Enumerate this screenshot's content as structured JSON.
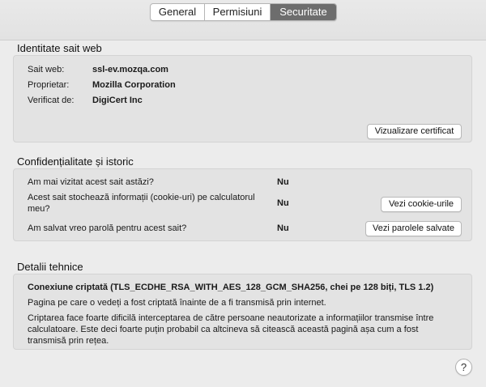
{
  "tabs": [
    "General",
    "Permisiuni",
    "Securitate"
  ],
  "identity": {
    "title": "Identitate sait web",
    "site_label": "Sait web:",
    "site_value": "ssl-ev.mozqa.com",
    "owner_label": "Proprietar:",
    "owner_value": "Mozilla Corporation",
    "verified_label": "Verificat de:",
    "verified_value": "DigiCert Inc",
    "view_cert_button": "Vizualizare certificat"
  },
  "privacy": {
    "title": "Confidențialitate și istoric",
    "q1": "Am mai vizitat acest sait astăzi?",
    "a1": "Nu",
    "q2_line1": "Acest sait stochează informații (cookie-uri) pe calculatorul",
    "q2_line2": "meu?",
    "a2": "Nu",
    "cookies_button": "Vezi cookie-urile",
    "q3": "Am salvat vreo parolă pentru acest sait?",
    "a3": "Nu",
    "passwords_button": "Vezi parolele salvate"
  },
  "technical": {
    "title": "Detalii tehnice",
    "connection": "Conexiune criptată (TLS_ECDHE_RSA_WITH_AES_128_GCM_SHA256, chei pe 128 biți, TLS 1.2)",
    "line1": "Pagina pe care o vedeți a fost criptată înainte de a fi transmisă prin internet.",
    "line2": "Criptarea face foarte dificilă interceptarea de către persoane neautorizate a informațiilor transmise între",
    "line3": "calculatoare. Este deci foarte puțin probabil ca altcineva să citească această pagină așa cum a fost",
    "line4": "transmisă prin rețea."
  },
  "help_glyph": "?"
}
